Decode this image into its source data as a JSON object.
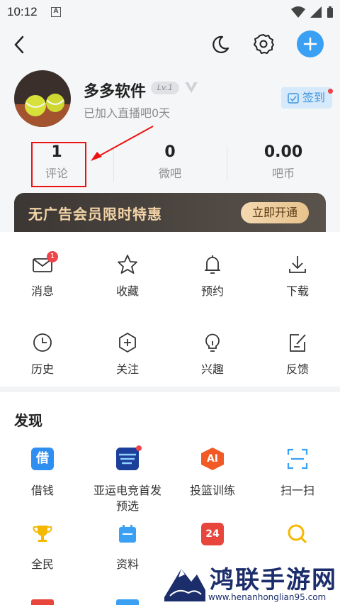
{
  "status_bar": {
    "time": "10:12",
    "notification_icon": "A"
  },
  "top_bar": {
    "icons": [
      "back-icon",
      "moon-icon",
      "gear-icon",
      "plus-icon"
    ]
  },
  "profile": {
    "username": "多多软件",
    "level": "Lv.1",
    "subtitle": "已加入直播吧0天",
    "signin_label": "签到"
  },
  "stats": [
    {
      "value": "1",
      "label": "评论"
    },
    {
      "value": "0",
      "label": "微吧"
    },
    {
      "value": "0.00",
      "label": "吧币"
    }
  ],
  "vip_banner": {
    "text": "无广告会员限时特惠",
    "button": "立即开通"
  },
  "menu": {
    "items": [
      {
        "label": "消息",
        "icon": "mail-icon",
        "badge": "1"
      },
      {
        "label": "收藏",
        "icon": "star-icon"
      },
      {
        "label": "预约",
        "icon": "bell-icon"
      },
      {
        "label": "下载",
        "icon": "download-icon"
      },
      {
        "label": "历史",
        "icon": "clock-icon"
      },
      {
        "label": "关注",
        "icon": "hexagon-plus-icon"
      },
      {
        "label": "兴趣",
        "icon": "lightbulb-icon"
      },
      {
        "label": "反馈",
        "icon": "edit-icon"
      }
    ]
  },
  "discover": {
    "title": "发现",
    "items": [
      {
        "label": "借钱",
        "icon": "loan-icon",
        "icon_text": "借",
        "color": "#2f8ff0"
      },
      {
        "label": "亚运电竞首发预选",
        "label_line1": "亚运电竞首发",
        "label_line2": "预选",
        "icon": "esports-icon",
        "color": "#1c3f9b"
      },
      {
        "label": "投篮训练",
        "icon": "ai-icon",
        "icon_text": "AI",
        "color": "#f15a24"
      },
      {
        "label": "扫一扫",
        "icon": "scan-icon",
        "color": "#3aa0f3"
      },
      {
        "label": "全民",
        "icon": "trophy-icon",
        "color": "#f5b800"
      },
      {
        "label": "资料",
        "icon": "calendar-icon",
        "color": "#3aa0f3"
      },
      {
        "label": "",
        "icon": "day24-icon",
        "icon_text": "24",
        "color": "#e8453c"
      },
      {
        "label": "",
        "icon": "search-icon",
        "color": "#f5b800"
      }
    ]
  },
  "watermark": {
    "brand": "鸿联手游网",
    "url": "www.henanhonglian95.com"
  },
  "colors": {
    "accent": "#3aa0f3",
    "badge_red": "#f0444b",
    "highlight": "#e11111"
  }
}
